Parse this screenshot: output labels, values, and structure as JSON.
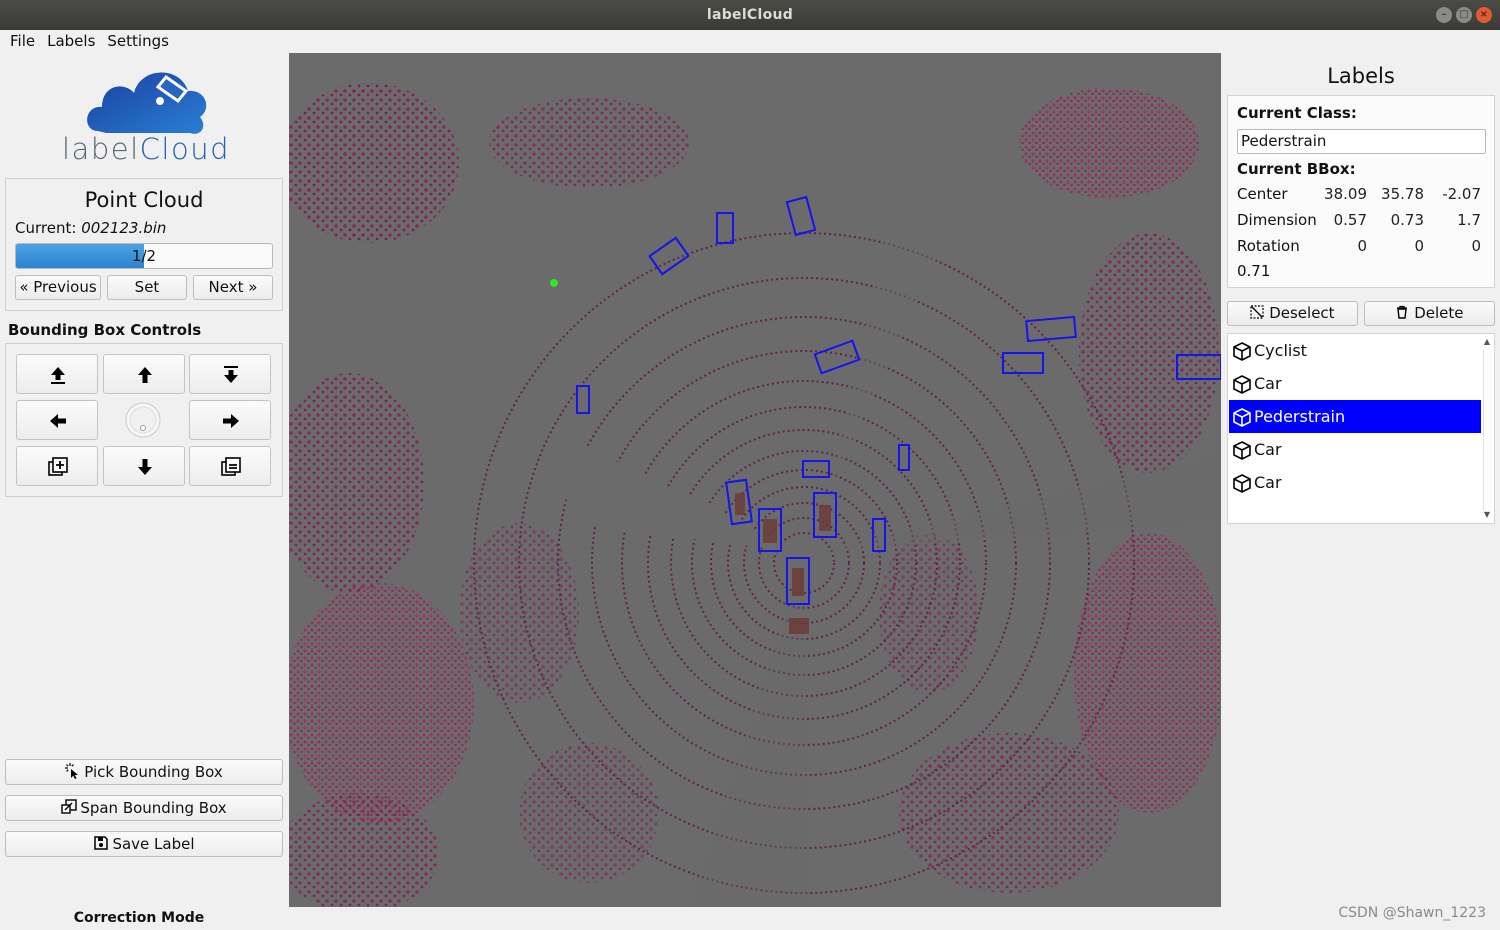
{
  "window": {
    "title": "labelCloud"
  },
  "menu": [
    "File",
    "Labels",
    "Settings"
  ],
  "logo": {
    "text_part1": "label",
    "text_part2": "Cloud"
  },
  "point_cloud": {
    "title": "Point Cloud",
    "current_label": "Current:",
    "current_file": "002123.bin",
    "progress_text": "1/2",
    "progress_value": 0.5,
    "previous_label": "« Previous",
    "set_label": "Set",
    "next_label": "Next »"
  },
  "bbox_controls": {
    "title": "Bounding Box Controls",
    "buttons": [
      "move-up",
      "move-forward",
      "move-down",
      "move-left",
      "rotate-dial",
      "move-right",
      "increase-size",
      "move-backward",
      "decrease-size"
    ]
  },
  "actions": {
    "pick_label": "Pick Bounding Box",
    "span_label": "Span Bounding Box",
    "save_label": "Save Label"
  },
  "mode_label": "Correction Mode",
  "labels_panel": {
    "title": "Labels",
    "current_class_heading": "Current Class:",
    "current_class_value": "Pederstrain",
    "current_bbox_heading": "Current BBox:",
    "center": {
      "label": "Center",
      "x": "38.09",
      "y": "35.78",
      "z": "-2.07"
    },
    "dimension": {
      "label": "Dimension",
      "x": "0.57",
      "y": "0.73",
      "z": "1.7"
    },
    "rotation": {
      "label": "Rotation",
      "x": "0",
      "y": "0",
      "z": "0"
    },
    "rotation_extra": "0.71",
    "deselect_label": "Deselect",
    "delete_label": "Delete",
    "items": [
      {
        "label": "Cyclist",
        "selected": false
      },
      {
        "label": "Car",
        "selected": false
      },
      {
        "label": "Pederstrain",
        "selected": true
      },
      {
        "label": "Car",
        "selected": false
      },
      {
        "label": "Car",
        "selected": false
      }
    ]
  },
  "watermark": "CSDN @Shawn_1223",
  "colors": {
    "selection": "#0000ff",
    "bbox": "#1010ee",
    "cloud": "#8a1f5a",
    "viewport_bg": "#6b6b6b",
    "progress": "#2b83cf"
  }
}
